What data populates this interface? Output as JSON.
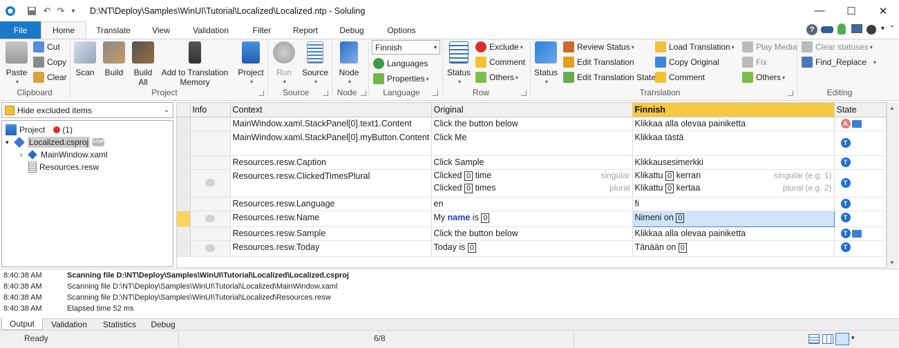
{
  "window": {
    "title": "D:\\NT\\Deploy\\Samples\\WinUI\\Tutorial\\Localized\\Localized.ntp  -  Soluling",
    "minimize": "—",
    "maximize": "☐",
    "close": "✕"
  },
  "tabs": [
    "File",
    "Home",
    "Translate",
    "View",
    "Validation",
    "Filter",
    "Report",
    "Debug",
    "Options"
  ],
  "ribbon": {
    "clipboard": {
      "paste": "Paste",
      "cut": "Cut",
      "copy": "Copy",
      "clear": "Clear",
      "group": "Clipboard"
    },
    "project": {
      "scan": "Scan",
      "build": "Build",
      "build_all": "Build All",
      "add_to_tm": "Add to Translation Memory",
      "project": "Project",
      "group": "Project"
    },
    "source": {
      "run": "Run",
      "source": "Source",
      "group": "Source"
    },
    "node": {
      "node": "Node",
      "group": "Node"
    },
    "language": {
      "selected": "Finnish",
      "languages": "Languages",
      "properties": "Properties",
      "group": "Language"
    },
    "row": {
      "status": "Status",
      "exclude": "Exclude",
      "comment": "Comment",
      "others": "Others",
      "group": "Row"
    },
    "translation": {
      "status": "Status",
      "review_status": "Review Status",
      "edit_translation": "Edit Translation",
      "edit_translation_state": "Edit Translation State",
      "load_translation": "Load Translation",
      "copy_original": "Copy Original",
      "comment": "Comment",
      "play_media": "Play Media",
      "fix": "Fix",
      "others": "Others",
      "group": "Translation"
    },
    "editing": {
      "clear_statuses": "Clear statuses",
      "find_replace": "Find_Replace",
      "group": "Editing"
    }
  },
  "left_panel": {
    "filter": "Hide excluded items",
    "tree": {
      "root": "Project",
      "root_count": "(1)",
      "project_file": "Localized.csproj",
      "stop_badge": "STOP",
      "children": [
        "MainWindow.xaml",
        "Resources.resw"
      ]
    }
  },
  "grid": {
    "columns": [
      "Info",
      "Context",
      "Original",
      "Finnish",
      "State"
    ],
    "rows": [
      {
        "context": "MainWindow.xaml.StackPanel[0].text1.Content",
        "original": "Click the button below",
        "target": "Klikkaa alla olevaa painiketta",
        "state": "A"
      },
      {
        "context": "MainWindow.xaml.StackPanel[0].myButton.Content",
        "original": "Click Me",
        "target": "Klikkaa tästä",
        "state": "T"
      },
      {
        "context": "Resources.resw.Caption",
        "original": "Click Sample",
        "target": "Klikkausesimerkki",
        "state": "T"
      },
      {
        "context": "Resources.resw.ClickedTimesPlural",
        "original_singular_a": "Clicked",
        "original_singular_b": "time",
        "original_plural_a": "Clicked",
        "original_plural_b": "times",
        "singular_tag": "singular",
        "plural_tag": "plural",
        "target_singular_a": "Klikattu",
        "target_singular_b": "kerran",
        "target_plural_a": "Klikattu",
        "target_plural_b": "kertaa",
        "target_singular_tag": "singular (e.g. 1)",
        "target_plural_tag": "plural (e.g. 2)",
        "state": "T"
      },
      {
        "context": "Resources.resw.Language",
        "original": "en",
        "target": "fi",
        "state": "T"
      },
      {
        "context": "Resources.resw.Name",
        "original_a": "My",
        "original_kw": "name",
        "original_b": "is",
        "target_a": "Nimeni",
        "target_b": "on",
        "state": "T"
      },
      {
        "context": "Resources.resw.Sample",
        "original": "Click the button below",
        "target": "Klikkaa alla olevaa painiketta",
        "state": "T"
      },
      {
        "context": "Resources.resw.Today",
        "original_a": "Today",
        "original_b": "is",
        "target_a": "Tänään",
        "target_b": "on",
        "state": "T"
      }
    ],
    "placeholder": "0"
  },
  "output": [
    {
      "time": "8:40:38 AM",
      "msg": "Scanning file D:\\NT\\Deploy\\Samples\\WinUI\\Tutorial\\Localized\\Localized.csproj"
    },
    {
      "time": "8:40:38 AM",
      "msg": "Scanning file D:\\NT\\Deploy\\Samples\\WinUI\\Tutorial\\Localized\\MainWindow.xaml"
    },
    {
      "time": "8:40:38 AM",
      "msg": "Scanning file D:\\NT\\Deploy\\Samples\\WinUI\\Tutorial\\Localized\\Resources.resw"
    },
    {
      "time": "8:40:38 AM",
      "msg": "Elapsed time 52 ms"
    }
  ],
  "bottom_tabs": [
    "Output",
    "Validation",
    "Statistics",
    "Debug"
  ],
  "status": {
    "text": "Ready",
    "count": "6/8"
  }
}
